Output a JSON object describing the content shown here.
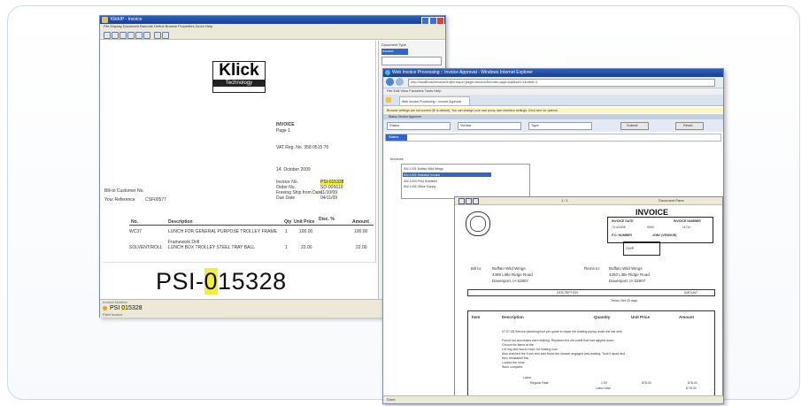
{
  "colors": {
    "titlebar": "#1c3f92",
    "highlight": "#f2ef3a",
    "frame": "#cfd9e6"
  },
  "left_window": {
    "title": "KlickIP - Invoice",
    "menu": "File  Display  Document  Barcode  Define  Browse Properties  Zoom  Help",
    "side_panel_label": "Document Type",
    "side_panel_value": "Invoice",
    "logo_text": "Klick",
    "logo_sub": "Technology",
    "doc_title": "INVOICE",
    "doc_page": "Page 1",
    "vat": "VAT Reg. No. 358 0515 76",
    "date": "14. October 2009",
    "invoice_no_label": "Invoice No.",
    "invoice_no_value": "PSI-015328",
    "order_no_label": "Order No.",
    "order_no_value": "SO-005619",
    "freight_label": "Freeing Ship from Date",
    "freight_value": "11/10/09",
    "due_label": "Due Date",
    "due_value": "04/11/09",
    "bill_label": "Bill-to Customer No.",
    "ref_label": "Your Reference",
    "ref_value": "CSF00577",
    "col_no": "No.",
    "col_desc": "Description",
    "col_qty": "Qty",
    "col_price": "Unit Price",
    "col_disc": "Disc. %",
    "col_amount": "Amount",
    "row1_no": "WC37",
    "row1_desc": "LUNCH FOR GENERAL PURPOSE TROLLEY FRAME",
    "row1_qty": "1",
    "row1_price": "100.00",
    "row1_amount": "100.00",
    "row2_pre": "Framework Drill",
    "row2_no": "SOLVENT/ROLL",
    "row2_desc": "LUNCH BOX TROLLEY STEEL TRAY BALL",
    "row2_qty": "1",
    "row2_price": "22.00",
    "row2_amount": "22.00",
    "zoom_prefix": "PSI-",
    "zoom_highlight": "0",
    "zoom_suffix": "15328",
    "field_label": "Invoice Number",
    "field_prefix": "PSI",
    "field_highlight": "0",
    "field_suffix": "15328",
    "status": "Field Invoice"
  },
  "right_window": {
    "title": "Web Invoice Processing :: Invoice Approval - Windows Internet Explorer",
    "url": "http://localhost/invoice/index.aspx?page=invoice&mode=approval&sel=1&view=1",
    "menu": "File  Edit  View  Favorites  Tools  Help",
    "tab_label": "Web Invoice Processing :: Invoice Approval",
    "notice": "Browser settings are not current (IE is default). You can change your own proxy user interface settings. Click here for options.",
    "filters_header": "Status  Vendor  Approver",
    "select1": "Status",
    "select2": "Vendor",
    "select3": "Type",
    "btn_submit": "Submit",
    "btn_reset": "Reset",
    "search_label": "Status",
    "list_header": "Invoices",
    "list_row1": "INV-1001  Buffalo Wild Wings",
    "list_row2": "INV-1002  Selected Invoice",
    "list_row3": "INV-1003  Print Solutions",
    "list_row4": "INV-1004  Office Supply",
    "viewer_page": "1 / 1",
    "viewer_tool": "Document Pane",
    "inv_title": "INVOICE",
    "inv_h1": "INVOICE DATE",
    "inv_h2": "INVOICE NUMBER",
    "inv_v1": "7/14/2008",
    "inv_v2": "9092",
    "inv_v3": "11711",
    "inv_h3": "P.O. NUMBER",
    "inv_h4": "JOB# (VENDOR)",
    "inv_ship": "SHIP",
    "bill_to_label": "Bill to:",
    "bill_to_name": "Buffalo Wild Wings",
    "bill_to_addr1": "4489 Little Ridge Road",
    "bill_to_addr2": "Davenport, IA  52807",
    "remit_label": "Remit to:",
    "remit_name": "Buffalo Wild Wings",
    "remit_addr1": "4250 Little Ridge Road",
    "remit_addr2": "Davenport, IA  52807",
    "desc_header": "DESCRIPTION",
    "amount_header": "AMOUNT",
    "terms": "Terms:  Net 30 days",
    "th_item": "Item",
    "th_desc": "Description",
    "th_qty": "Quantity",
    "th_price": "Unit Price",
    "th_amount": "Amount",
    "line1": "07-07-08  Service plumbing/roof per quote to repair the leaking piping under the bar sink.",
    "line2": "Found hot and drains were leaking. Replaced the old cutoff that had slipped down",
    "line3": "Ground for items at the",
    "line4": "Lid ring and faucet hose not leaking now.",
    "line5": "Also checked the fl ush trim and found the shower engaged was leaking. Took it apart and",
    "line6": "then reinstalled this",
    "line7": "Locked the hose.",
    "line8": "Work complete.",
    "labor_label": "Labor",
    "regular_rate": "Regular Rate",
    "qty_val": "1.00",
    "rate_val": "$78.00",
    "amt_val": "$78.00",
    "labor_total_label": "Labor total",
    "labor_total": "$ 78.00",
    "status": "Done"
  }
}
